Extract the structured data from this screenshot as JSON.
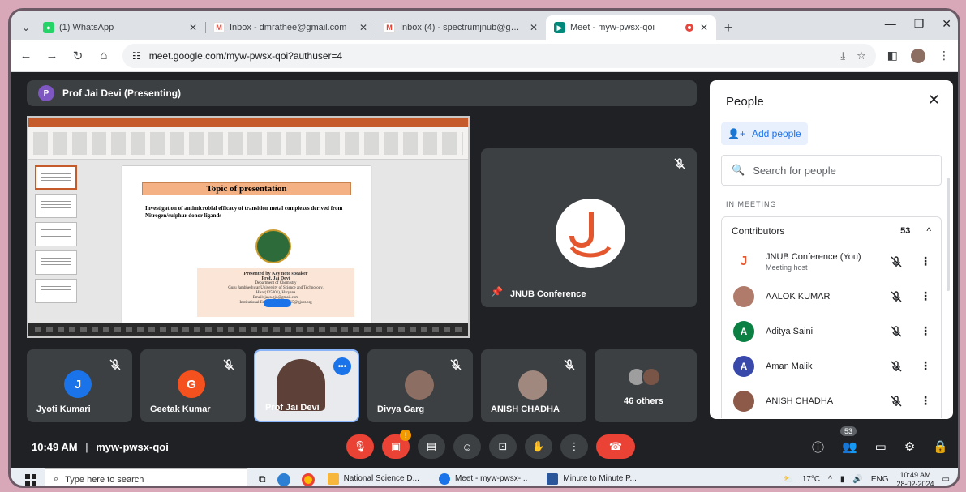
{
  "colors": {
    "meet_bg": "#202124",
    "tile_bg": "#3c4043",
    "accent": "#1a73e8",
    "danger": "#ea4335",
    "jnub_orange": "#e4572e"
  },
  "browser": {
    "tabs": [
      {
        "icon": "whatsapp-icon",
        "title": "(1) WhatsApp",
        "active": false
      },
      {
        "icon": "gmail-icon",
        "title": "Inbox - dmrathee@gmail.com",
        "active": false
      },
      {
        "icon": "gmail-icon",
        "title": "Inbox (4) - spectrumjnub@gmail",
        "active": false
      },
      {
        "icon": "meet-icon",
        "title": "Meet - myw-pwsx-qoi",
        "active": true
      }
    ],
    "url": "meet.google.com/myw-pwsx-qoi?authuser=4"
  },
  "meet": {
    "presenter_label": "Prof Jai Devi (Presenting)",
    "presenter_initial": "P",
    "main_tile_name": "JNUB Conference",
    "meeting_time": "10:49 AM",
    "meeting_code": "myw-pwsx-qoi",
    "people_count_badge": "53",
    "mic_badge": "!"
  },
  "slide": {
    "heading": "Topic of presentation",
    "subtitle": "Investigation of antimicrobial efficacy of transition metal complexes derived from Nitrogen/sulphur donor ligands",
    "presenter_box": "Presented by Key note speaker",
    "presenter_name": "Prof. Jai Devi",
    "department": "Department of Chemistry",
    "university": "Guru Jambheshwar University of Science and Technology,",
    "location": "Hisar(125001), Haryana",
    "email": "Email: jaya.gju@gmail.com",
    "inst_email": "Institutional Email: jd_chem1965@gjust.org"
  },
  "tiles": [
    {
      "name": "Jyoti Kumari",
      "initial": "J",
      "color": "#1a73e8"
    },
    {
      "name": "Geetak Kumar",
      "initial": "G",
      "color": "#f4511e"
    },
    {
      "name": "Prof Jai Devi",
      "initial": "",
      "color": "#5f6368"
    },
    {
      "name": "Divya Garg",
      "initial": "",
      "color": "#8d6e63"
    },
    {
      "name": "ANISH CHADHA",
      "initial": "",
      "color": "#a1887f"
    },
    {
      "name": "46 others",
      "initial": "",
      "color": "#5f6368"
    }
  ],
  "people": {
    "title": "People",
    "add_label": "Add people",
    "search_placeholder": "Search for people",
    "section": "IN MEETING",
    "group_label": "Contributors",
    "group_count": "53",
    "list": [
      {
        "name": "JNUB Conference (You)",
        "role": "Meeting host",
        "initial": "J",
        "color": "#ffffff"
      },
      {
        "name": "AALOK KUMAR",
        "role": "",
        "initial": "",
        "color": "#b07b6a"
      },
      {
        "name": "Aditya Saini",
        "role": "",
        "initial": "A",
        "color": "#0b8043"
      },
      {
        "name": "Aman Malik",
        "role": "",
        "initial": "A",
        "color": "#3949ab"
      },
      {
        "name": "ANISH CHADHA",
        "role": "",
        "initial": "",
        "color": "#8d5a4a"
      }
    ]
  },
  "taskbar": {
    "search_placeholder": "Type here to search",
    "apps": [
      {
        "label": "National Science D...",
        "color": "#f6b73c"
      },
      {
        "label": "Meet - myw-pwsx-...",
        "color": "#1a73e8"
      },
      {
        "label": "Minute to Minute P...",
        "color": "#2b579a"
      }
    ],
    "temperature": "17°C",
    "lang": "ENG",
    "clock_time": "10:49 AM",
    "clock_date": "28-02-2024"
  }
}
